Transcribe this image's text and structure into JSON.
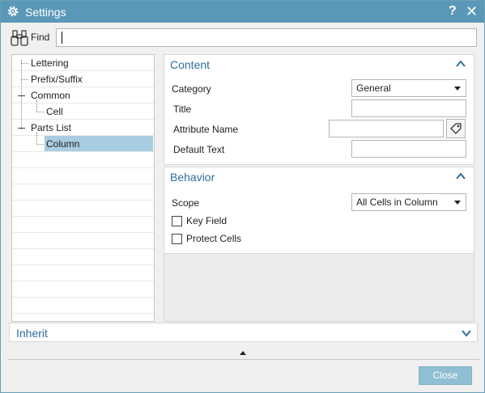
{
  "window": {
    "title": "Settings",
    "help_label": "?",
    "close_label": "✕"
  },
  "find": {
    "label": "Find",
    "value": "",
    "placeholder": ""
  },
  "tree": {
    "items": [
      {
        "label": "Lettering",
        "level": 1,
        "selected": false
      },
      {
        "label": "Prefix/Suffix",
        "level": 1,
        "selected": false
      },
      {
        "label": "Common",
        "level": 1,
        "selected": false,
        "expanded": true
      },
      {
        "label": "Cell",
        "level": 2,
        "selected": false
      },
      {
        "label": "Parts List",
        "level": 1,
        "selected": false,
        "expanded": true
      },
      {
        "label": "Column",
        "level": 2,
        "selected": true
      }
    ]
  },
  "content": {
    "title": "Content",
    "category_label": "Category",
    "category_value": "General",
    "title_label": "Title",
    "title_value": "",
    "attribute_label": "Attribute Name",
    "attribute_value": "",
    "default_label": "Default Text",
    "default_value": ""
  },
  "behavior": {
    "title": "Behavior",
    "scope_label": "Scope",
    "scope_value": "All Cells in Column",
    "key_field_label": "Key Field",
    "key_field_checked": false,
    "protect_label": "Protect Cells",
    "protect_checked": false
  },
  "inherit": {
    "title": "Inherit"
  },
  "footer": {
    "close_label": "Close"
  },
  "colors": {
    "titlebar": "#5a98b8",
    "section_title": "#2d6f9b",
    "selection": "#a9cde0",
    "close_button": "#8fbfd3"
  },
  "icons": {
    "window": "gear-icon",
    "find": "binoculars-icon",
    "attribute": "tag-icon",
    "collapse": "chevron-up-icon",
    "expand": "chevron-down-icon"
  }
}
